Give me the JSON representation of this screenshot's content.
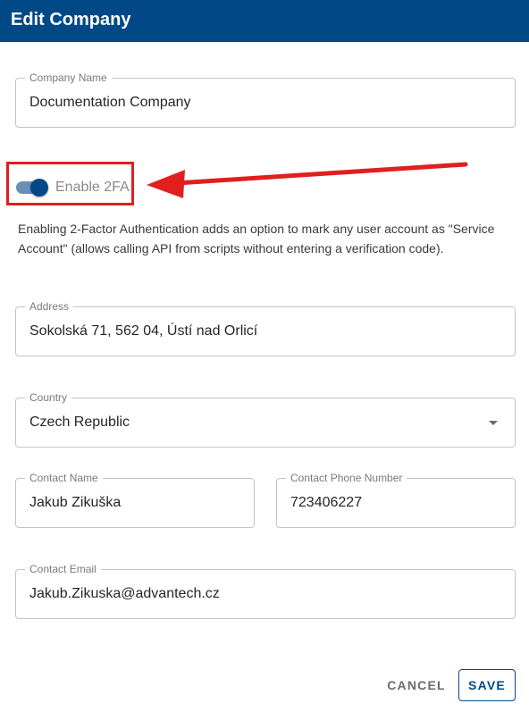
{
  "dialog": {
    "title": "Edit Company"
  },
  "company_name": {
    "label": "Company Name",
    "value": "Documentation Company"
  },
  "two_fa": {
    "label": "Enable 2FA",
    "enabled": true,
    "help": "Enabling 2-Factor Authentication adds an option to mark any user account as \"Service Account\" (allows calling API from scripts without entering a verification code)."
  },
  "address": {
    "label": "Address",
    "value": "Sokolská 71, 562 04, Ústí nad Orlicí"
  },
  "country": {
    "label": "Country",
    "value": "Czech Republic"
  },
  "contact_name": {
    "label": "Contact Name",
    "value": "Jakub Zikuška"
  },
  "contact_phone": {
    "label": "Contact Phone Number",
    "value": "723406227"
  },
  "contact_email": {
    "label": "Contact Email",
    "value": "Jakub.Zikuska@advantech.cz"
  },
  "actions": {
    "cancel": "CANCEL",
    "save": "SAVE"
  },
  "colors": {
    "primary": "#014986",
    "annotation": "#e01f1f"
  },
  "icons": {
    "country_dropdown": "caret-down-icon"
  }
}
